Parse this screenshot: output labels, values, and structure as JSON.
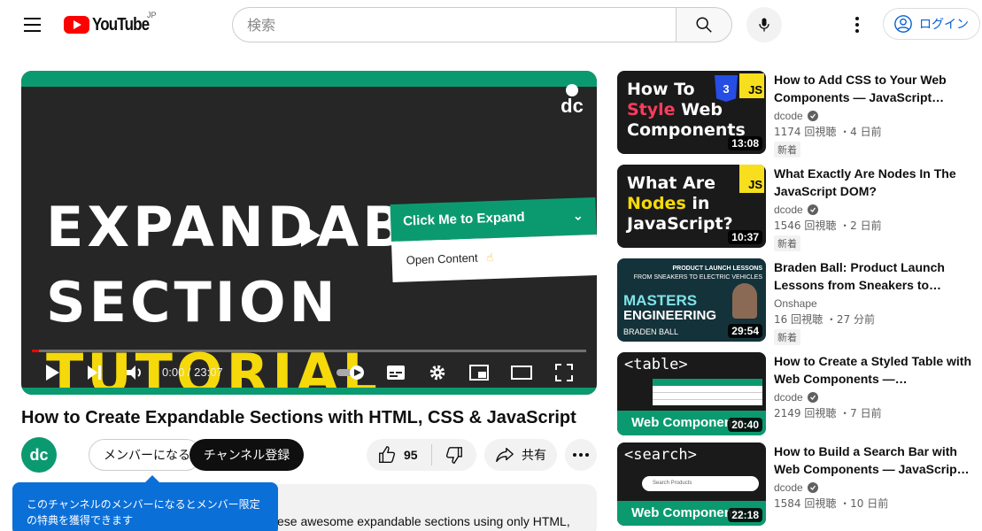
{
  "header": {
    "logo_text": "YouTube",
    "region": "JP",
    "search_placeholder": "検索",
    "login_label": "ログイン"
  },
  "player": {
    "thumb_line1": "EXPANDABLE",
    "thumb_line2": "SECTION",
    "thumb_line3": "TUTORIAL",
    "accordion_header": "Click Me to Expand",
    "accordion_body": "Open Content",
    "brand_mark": "dc",
    "time": "0:00 / 23:07",
    "progress_fraction": 0
  },
  "video": {
    "title": "How to Create Expandable Sections with HTML, CSS & JavaScript",
    "channel_avatar": "dc",
    "member_label": "メンバーになる",
    "subscribe_label": "チャンネル登録",
    "likes": "95",
    "share_label": "共有",
    "description_snippet": "ese awesome expandable sections using only HTML,",
    "member_tooltip": "このチャンネルのメンバーになるとメンバー限定の特典を獲得できます"
  },
  "recommendations": [
    {
      "title": "How to Add CSS to Your Web Components — JavaScript…",
      "channel": "dcode",
      "meta": "1174 回視聴 ・4 日前",
      "badge": "新着",
      "duration": "13:08",
      "thumb_lines": [
        "How To",
        "Style",
        " Web",
        "Components"
      ],
      "thumb_badges": [
        "JS",
        "3"
      ]
    },
    {
      "title": "What Exactly Are Nodes In The JavaScript DOM?",
      "channel": "dcode",
      "meta": "1546 回視聴 ・2 日前",
      "badge": "新着",
      "duration": "10:37",
      "thumb_lines": [
        "What Are",
        "Nodes",
        " in",
        "JavaScript?"
      ],
      "thumb_badges": [
        "JS"
      ]
    },
    {
      "title": "Braden Ball: Product Launch Lessons from Sneakers to…",
      "channel": "Onshape",
      "meta": "16 回視聴 ・27 分前",
      "badge": "新着",
      "duration": "29:54",
      "thumb_lines": [
        "PRODUCT LAUNCH LESSONS",
        "FROM SNEAKERS TO ELECTRIC VEHICLES",
        "MASTERS",
        "ENGINEERING",
        "BRADEN BALL"
      ],
      "thumb_badges": []
    },
    {
      "title": "How to Create a Styled Table with Web Components —…",
      "channel": "dcode",
      "meta": "2149 回視聴 ・7 日前",
      "badge": "",
      "duration": "20:40",
      "thumb_lines": [
        "<table>",
        "Web Components"
      ],
      "thumb_badges": []
    },
    {
      "title": "How to Build a Search Bar with Web Components — JavaScrip…",
      "channel": "dcode",
      "meta": "1584 回視聴 ・10 日前",
      "badge": "",
      "duration": "22:18",
      "thumb_lines": [
        "<search>",
        "Web Components",
        "Search Products"
      ],
      "thumb_badges": []
    }
  ],
  "colors": {
    "brand_red": "#ff0000",
    "accent_green": "#0b9a70",
    "link_blue": "#065fd4",
    "tooltip_blue": "#0b6fd8"
  },
  "icons": [
    "menu-icon",
    "search-icon",
    "mic-icon",
    "more-vert-icon",
    "account-icon",
    "play-icon",
    "next-icon",
    "volume-icon",
    "autoplay-toggle-icon",
    "captions-icon",
    "settings-icon",
    "miniplayer-icon",
    "theater-icon",
    "fullscreen-icon",
    "like-icon",
    "dislike-icon",
    "share-icon",
    "more-horiz-icon",
    "verified-icon"
  ]
}
